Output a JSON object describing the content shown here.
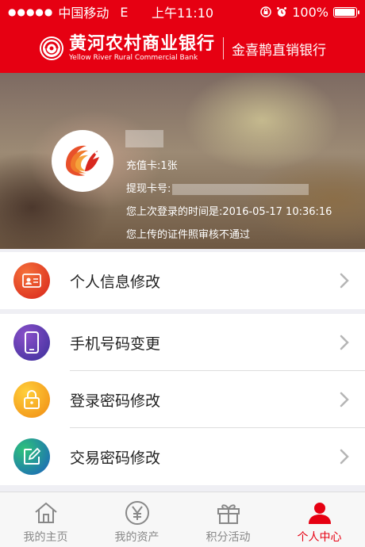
{
  "status_bar": {
    "carrier": "中国移动",
    "network": "E",
    "time": "上午11:10",
    "battery_text": "100%",
    "battery_level": 1.0
  },
  "header": {
    "bank_name_cn": "黄河农村商业银行",
    "bank_name_en": "Yellow River Rural Commercial Bank",
    "subtitle": "金喜鹊直销银行"
  },
  "profile": {
    "recharge_card": "充值卡:1张",
    "withdraw_card_label": "提现卡号:",
    "last_login": "您上次登录的时间是:2016-05-17 10:36:16",
    "id_status": "您上传的证件照审核不通过"
  },
  "menu": {
    "personal_info": "个人信息修改",
    "phone_change": "手机号码变更",
    "login_password": "登录密码修改",
    "trade_password": "交易密码修改"
  },
  "tabs": [
    {
      "label": "我的主页",
      "icon": "home-icon"
    },
    {
      "label": "我的资产",
      "icon": "yuan-icon"
    },
    {
      "label": "积分活动",
      "icon": "gift-icon"
    },
    {
      "label": "个人中心",
      "icon": "person-icon"
    }
  ],
  "colors": {
    "brand_red": "#e60012",
    "inactive_tab": "#888888"
  }
}
